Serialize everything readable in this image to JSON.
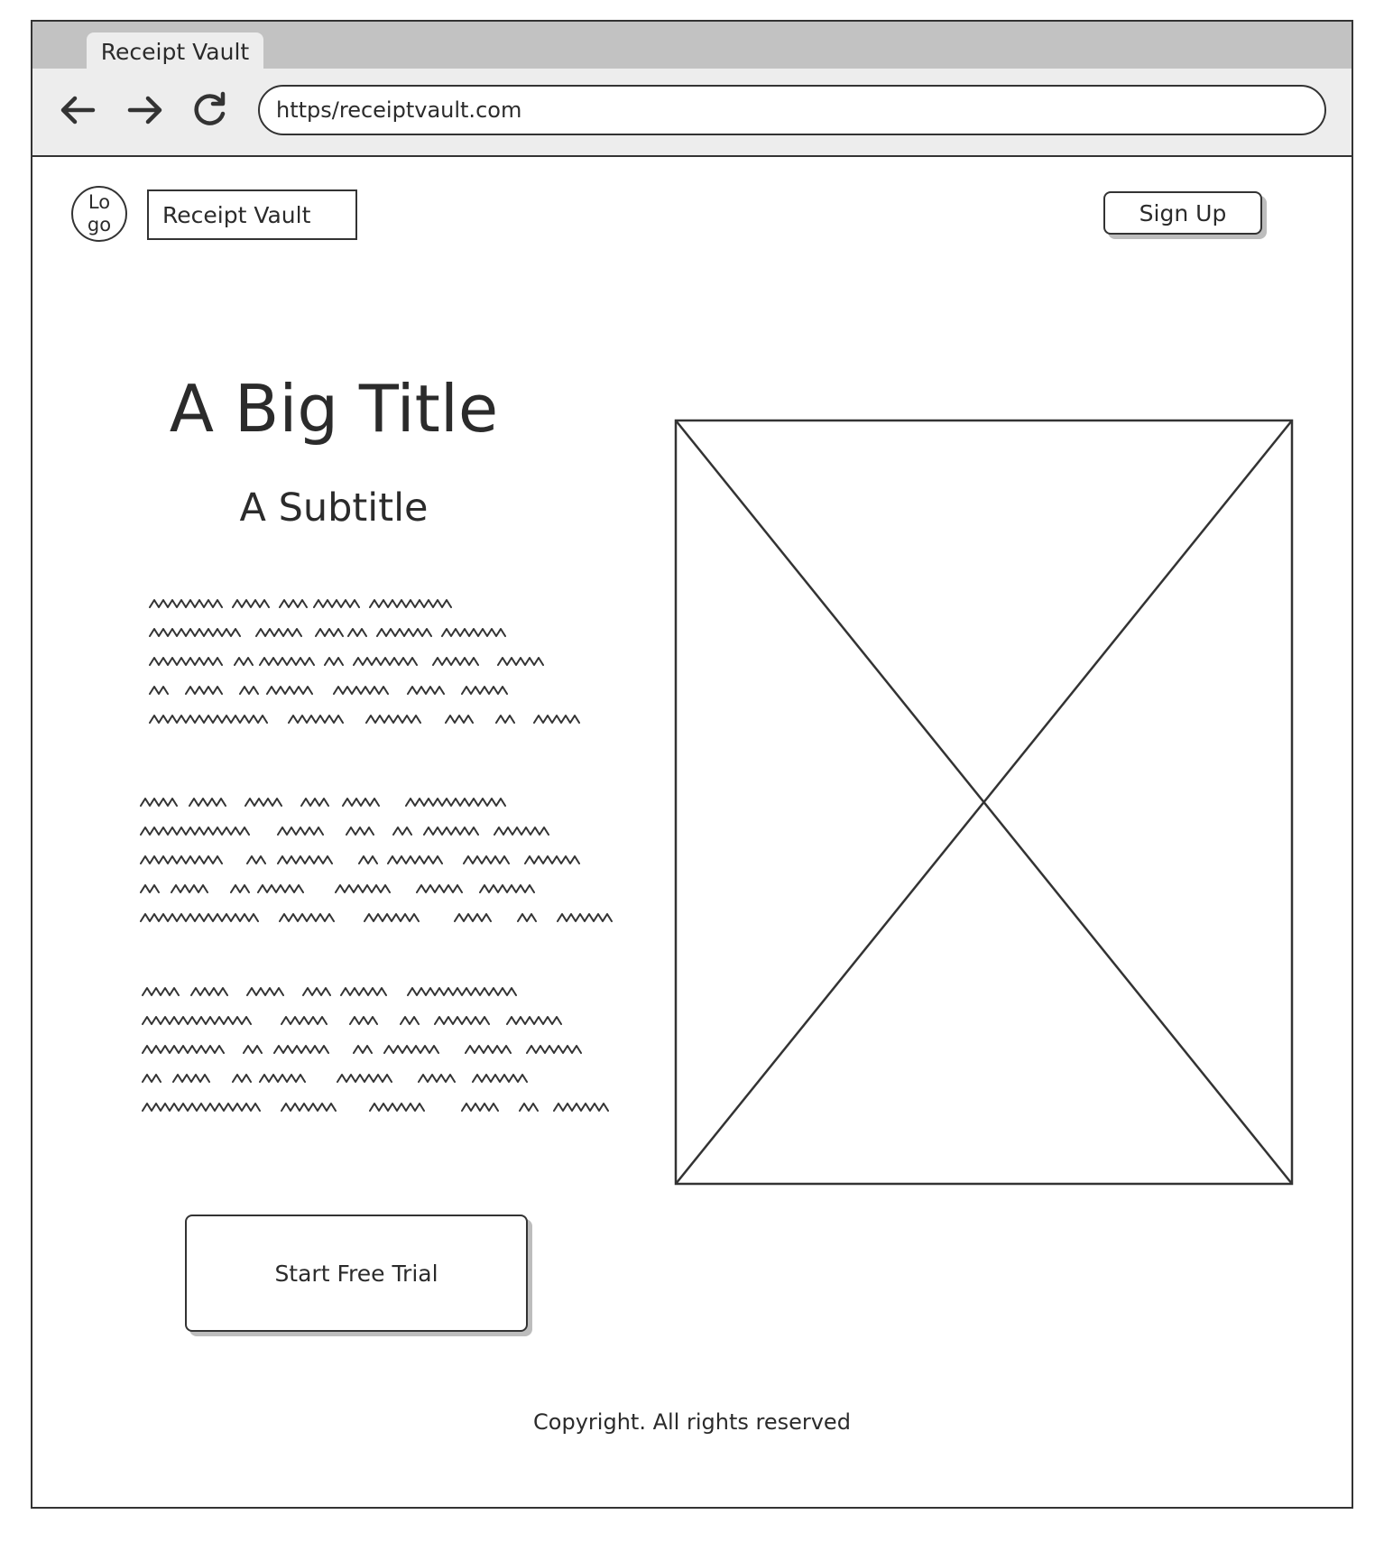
{
  "browser": {
    "tab_title": "Receipt Vault",
    "url": "https/receiptvault.com",
    "back_icon": "arrow-left-icon",
    "forward_icon": "arrow-right-icon",
    "reload_icon": "reload-icon"
  },
  "header": {
    "logo_line1": "Lo",
    "logo_line2": "go",
    "brand_name": "Receipt Vault",
    "signup_label": "Sign Up"
  },
  "hero": {
    "title": "A Big Title",
    "subtitle": "A Subtitle",
    "cta_label": "Start Free Trial"
  },
  "footer": {
    "copyright": "Copyright. All rights reserved"
  }
}
